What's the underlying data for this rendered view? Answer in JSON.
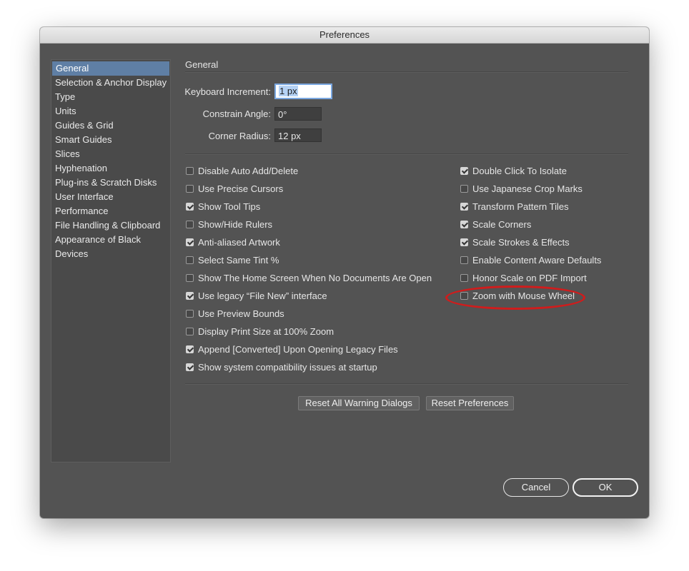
{
  "window": {
    "title": "Preferences"
  },
  "sidebar": {
    "items": [
      {
        "label": "General",
        "selected": true
      },
      {
        "label": "Selection & Anchor Display"
      },
      {
        "label": "Type"
      },
      {
        "label": "Units"
      },
      {
        "label": "Guides & Grid"
      },
      {
        "label": "Smart Guides"
      },
      {
        "label": "Slices"
      },
      {
        "label": "Hyphenation"
      },
      {
        "label": "Plug-ins & Scratch Disks"
      },
      {
        "label": "User Interface"
      },
      {
        "label": "Performance"
      },
      {
        "label": "File Handling & Clipboard"
      },
      {
        "label": "Appearance of Black"
      },
      {
        "label": "Devices"
      }
    ]
  },
  "general": {
    "title": "General",
    "keyboard_increment": {
      "label": "Keyboard Increment:",
      "value": "1 px"
    },
    "constrain_angle": {
      "label": "Constrain Angle:",
      "value": "0°"
    },
    "corner_radius": {
      "label": "Corner Radius:",
      "value": "12 px"
    }
  },
  "options_left": [
    {
      "label": "Disable Auto Add/Delete",
      "checked": false
    },
    {
      "label": "Use Precise Cursors",
      "checked": false
    },
    {
      "label": "Show Tool Tips",
      "checked": true
    },
    {
      "label": "Show/Hide Rulers",
      "checked": false
    },
    {
      "label": "Anti-aliased Artwork",
      "checked": true
    },
    {
      "label": "Select Same Tint %",
      "checked": false
    },
    {
      "label": "Show The Home Screen When No Documents Are Open",
      "checked": false
    },
    {
      "label": "Use legacy “File New” interface",
      "checked": true
    },
    {
      "label": "Use Preview Bounds",
      "checked": false
    },
    {
      "label": "Display Print Size at 100% Zoom",
      "checked": false
    },
    {
      "label": "Append [Converted] Upon Opening Legacy Files",
      "checked": true
    },
    {
      "label": "Show system compatibility issues at startup",
      "checked": true
    }
  ],
  "options_right": [
    {
      "label": "Double Click To Isolate",
      "checked": true
    },
    {
      "label": "Use Japanese Crop Marks",
      "checked": false
    },
    {
      "label": "Transform Pattern Tiles",
      "checked": true
    },
    {
      "label": "Scale Corners",
      "checked": true
    },
    {
      "label": "Scale Strokes & Effects",
      "checked": true
    },
    {
      "label": "Enable Content Aware Defaults",
      "checked": false
    },
    {
      "label": "Honor Scale on PDF Import",
      "checked": false
    },
    {
      "label": "Zoom with Mouse Wheel",
      "checked": false
    }
  ],
  "buttons": {
    "reset_warnings": "Reset All Warning Dialogs",
    "reset_prefs": "Reset Preferences",
    "cancel": "Cancel",
    "ok": "OK"
  },
  "colors": {
    "panel_bg": "#535353",
    "selection": "#5f7fa5",
    "highlight_ring": "#d01c1c"
  }
}
